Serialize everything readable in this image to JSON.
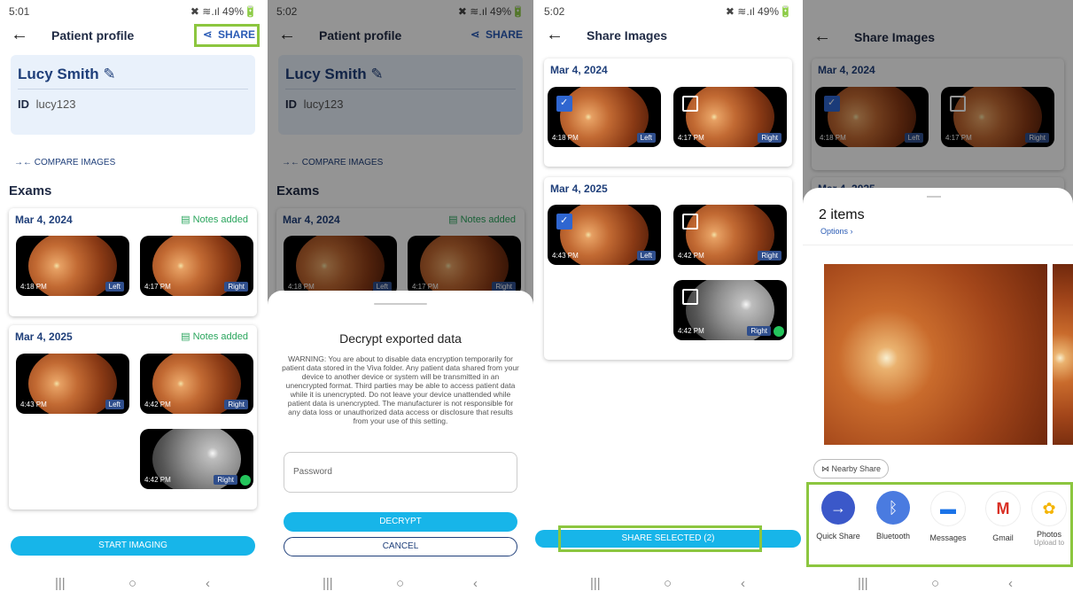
{
  "panels": [
    {
      "status": {
        "time": "5:01",
        "icons": "✖ ≋.ıl 49%🔋"
      },
      "appbar": {
        "title": "Patient profile",
        "back_icon": "←",
        "share_icon": "⋖",
        "share": "SHARE"
      },
      "patient": {
        "name": "Lucy Smith",
        "edit_icon": "✎",
        "id_label": "ID",
        "id_value": "lucy123"
      },
      "compare": {
        "icon": "→←",
        "label": "COMPARE IMAGES"
      },
      "exams_heading": "Exams",
      "exams": [
        {
          "date": "Mar 4, 2024",
          "notes": "▤ Notes added",
          "images": [
            {
              "time": "4:18 PM",
              "eye": "Left"
            },
            {
              "time": "4:17 PM",
              "eye": "Right"
            }
          ]
        },
        {
          "date": "Mar 4, 2025",
          "notes": "▤ Notes added",
          "images": [
            {
              "time": "4:43 PM",
              "eye": "Left"
            },
            {
              "time": "4:42 PM",
              "eye": "Right"
            },
            {
              "time": "4:42 PM",
              "eye": "Right"
            }
          ]
        }
      ],
      "start_button": "START IMAGING"
    },
    {
      "status": {
        "time": "5:02",
        "icons": "✖ ≋.ıl 49%🔋"
      },
      "appbar": {
        "title": "Patient profile",
        "back_icon": "←",
        "share_icon": "⋖",
        "share": "SHARE"
      },
      "patient": {
        "name": "Lucy Smith",
        "edit_icon": "✎",
        "id_label": "ID",
        "id_value": "lucy123"
      },
      "compare": {
        "icon": "→←",
        "label": "COMPARE IMAGES"
      },
      "exams_heading": "Exams",
      "exams": [
        {
          "date": "Mar 4, 2024",
          "notes": "▤ Notes added",
          "images": [
            {
              "time": "4:18 PM",
              "eye": "Left"
            },
            {
              "time": "4:17 PM",
              "eye": "Right"
            }
          ]
        }
      ],
      "dialog": {
        "title": "Decrypt exported data",
        "warning": "WARNING: You are about to disable data encryption temporarily for patient data stored in the Viva folder. Any patient data shared from your device to another device or system will be transmitted in an unencrypted format. Third parties may be able to access patient data while it is unencrypted. Do not leave your device unattended while patient data is unencrypted. The manufacturer is not responsible for any data loss or unauthorized data access or disclosure that results from your use of this setting.",
        "password_placeholder": "Password",
        "decrypt": "DECRYPT",
        "cancel": "CANCEL"
      }
    },
    {
      "status": {
        "time": "5:02",
        "icons": "✖ ≋.ıl 49%🔋"
      },
      "appbar": {
        "title": "Share Images",
        "back_icon": "←"
      },
      "exams": [
        {
          "date": "Mar 4, 2024",
          "images": [
            {
              "time": "4:18 PM",
              "eye": "Left",
              "checked": true
            },
            {
              "time": "4:17 PM",
              "eye": "Right",
              "checked": false
            }
          ]
        },
        {
          "date": "Mar 4, 2025",
          "images": [
            {
              "time": "4:43 PM",
              "eye": "Left",
              "checked": true
            },
            {
              "time": "4:42 PM",
              "eye": "Right",
              "checked": false
            },
            {
              "time": "4:42 PM",
              "eye": "Right",
              "checked": false
            }
          ]
        }
      ],
      "share_selected": "SHARE SELECTED (2)"
    },
    {
      "appbar": {
        "title": "Share Images",
        "back_icon": "←"
      },
      "exams": [
        {
          "date": "Mar 4, 2024",
          "images": [
            {
              "time": "4:18 PM",
              "eye": "Left",
              "checked": true
            },
            {
              "time": "4:17 PM",
              "eye": "Right",
              "checked": false
            }
          ]
        },
        {
          "date": "Mar 4, 2025"
        }
      ],
      "sheet": {
        "count": "2 items",
        "options": "Options ›",
        "nearby": "⋈ Nearby Share",
        "apps": [
          {
            "label": "Quick Share",
            "sub": "",
            "icon": "→",
            "color": "#3b58c9"
          },
          {
            "label": "Bluetooth",
            "sub": "",
            "icon": "ᛒ",
            "color": "#4a7be0"
          },
          {
            "label": "Messages",
            "sub": "",
            "icon": "▬",
            "color": "#1a73e8"
          },
          {
            "label": "Gmail",
            "sub": "",
            "icon": "M",
            "color": "#ffffff"
          },
          {
            "label": "Photos",
            "sub": "Upload to",
            "icon": "✿",
            "color": "#ffffff"
          }
        ]
      }
    }
  ],
  "navbar": {
    "recent": "|||",
    "home": "○",
    "back": "‹"
  },
  "highlight_color": "#8cc63f",
  "accent": "#17b5e9"
}
